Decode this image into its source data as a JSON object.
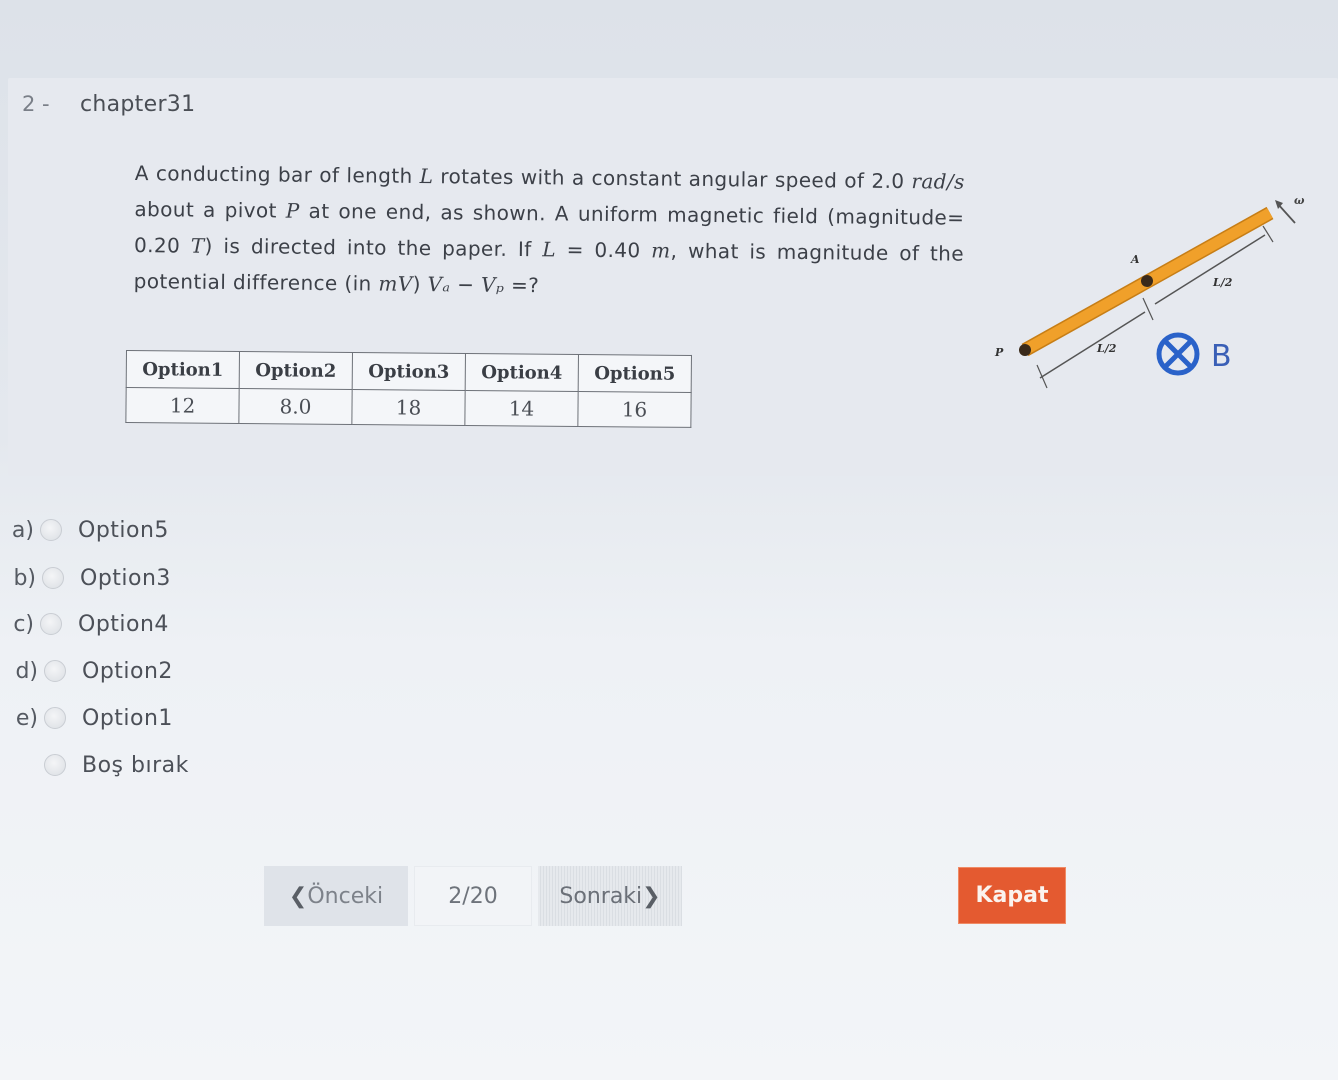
{
  "question": {
    "number": "2 -",
    "title": "chapter31",
    "text_parts": {
      "p1": "A conducting bar of length ",
      "L1": "L",
      "p2": " rotates with a constant angular speed of ",
      "omega_val": "2.0",
      "omega_unit": "rad/s",
      "p3": " about a pivot ",
      "P": "P",
      "p4": " at one end, as shown. A uniform magnetic field (magnitude= 0.20 ",
      "T": "T",
      "p5": ") is directed into the paper. If ",
      "L2": "L",
      "p6": " = 0.40 ",
      "m": "m",
      "p7": ", what is magnitude of the potential difference (in ",
      "mV": "mV",
      "p8": ")  ",
      "VA": "Vₐ",
      "p9": " − ",
      "VP": "Vₚ",
      "p10": " =?"
    }
  },
  "options_table": {
    "headers": [
      "Option1",
      "Option2",
      "Option3",
      "Option4",
      "Option5"
    ],
    "values": [
      "12",
      "8.0",
      "18",
      "14",
      "16"
    ]
  },
  "diagram": {
    "labels": {
      "pivot": "P",
      "midpoint": "A",
      "half_length_1": "L/2",
      "half_length_2": "L/2",
      "angular_speed": "ω",
      "field": "B"
    },
    "colors": {
      "bar": "#f0a02a",
      "field_symbol": "#2a62c9"
    },
    "icons": [
      "into-page-field-icon"
    ]
  },
  "answers": [
    {
      "letter": "a)",
      "label": "Option5",
      "selected": false
    },
    {
      "letter": "b)",
      "label": "Option3",
      "selected": false
    },
    {
      "letter": "c)",
      "label": "Option4",
      "selected": false
    },
    {
      "letter": "d)",
      "label": "Option2",
      "selected": false
    },
    {
      "letter": "e)",
      "label": "Option1",
      "selected": false
    },
    {
      "letter": "",
      "label": "Boş bırak",
      "selected": false
    }
  ],
  "navigation": {
    "prev_chevron": "❮",
    "prev_label": "Önceki",
    "page_counter": "2/20",
    "next_label": "Sonraki",
    "next_chevron": "❯",
    "close_label": "Kapat"
  },
  "colors": {
    "close_button": "#e45a30",
    "bar": "#f0a02a",
    "field_symbol": "#2a62c9"
  }
}
